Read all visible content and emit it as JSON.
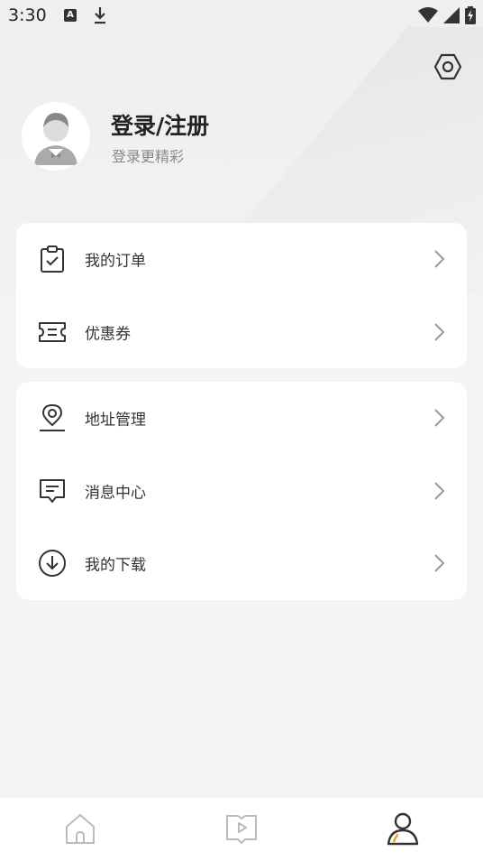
{
  "status_bar": {
    "time": "3:30",
    "notif_icons": [
      "app-a-icon",
      "download-icon"
    ],
    "right_icons": [
      "wifi-icon",
      "cell-signal-icon",
      "battery-charging-icon"
    ],
    "a_glyph": "A"
  },
  "profile": {
    "title": "登录/注册",
    "subtitle": "登录更精彩"
  },
  "menu_group_1": [
    {
      "label": "我的订单",
      "icon": "order-clipboard-icon"
    },
    {
      "label": "优惠券",
      "icon": "coupon-ticket-icon"
    }
  ],
  "menu_group_2": [
    {
      "label": "地址管理",
      "icon": "location-pin-icon"
    },
    {
      "label": "消息中心",
      "icon": "message-bubble-icon"
    },
    {
      "label": "我的下载",
      "icon": "download-circle-icon"
    }
  ],
  "tabbar": [
    {
      "name": "home",
      "icon": "home-icon",
      "active": false
    },
    {
      "name": "video",
      "icon": "video-book-icon",
      "active": false
    },
    {
      "name": "profile",
      "icon": "person-icon",
      "active": true
    }
  ],
  "colors": {
    "accent": "#f39c2f",
    "text": "#333333",
    "muted": "#888888",
    "icon": "#444444",
    "inactive_icon": "#bbbbbb"
  }
}
